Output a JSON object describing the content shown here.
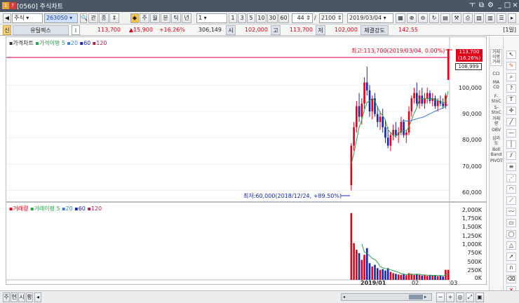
{
  "window": {
    "title": "[0560] 주식차트"
  },
  "toolbar1": {
    "market": "주식",
    "code": "263050",
    "buttons": [
      "관",
      "종"
    ],
    "periods": [
      "주",
      "월",
      "분",
      "틱",
      "년"
    ],
    "interval_value": "1",
    "interval_options": [
      "1",
      "3",
      "5",
      "10",
      "30",
      "60"
    ],
    "count_value": "44",
    "count_total": "2100",
    "date": "2019/03/04"
  },
  "toolbar2": {
    "stock_name": "유틸렉스",
    "info_icon": "i",
    "price": "113,700",
    "change": "▲15,900",
    "change_pct": "+16.26%",
    "volume": "306,149",
    "open_label": "시",
    "open": "102,000",
    "high_label": "고",
    "high": "113,700",
    "low_label": "저",
    "low": "102,000",
    "strength_label": "체결강도",
    "strength": "142.55",
    "period_badge": "[1일]"
  },
  "price_legend": {
    "title": "가격차트",
    "ma_label": "가격이평",
    "ma_periods": [
      "5",
      "20",
      "60",
      "120"
    ]
  },
  "volume_legend": {
    "title": "거래량",
    "ma_label": "거래이평",
    "ma_periods": [
      "5",
      "20",
      "60",
      "120"
    ]
  },
  "annotations": {
    "high": "최고:113,700(2019/03/04, 0.00%)",
    "low": "최저:60,000(2018/12/24, +89.50%)",
    "last_price": "113,700",
    "last_pct": "(16.26%)",
    "cursor_price": "108,999"
  },
  "price_axis": [
    "100,000",
    "90,000",
    "80,000",
    "70,000",
    "60,000"
  ],
  "volume_axis": [
    "2,000K",
    "1,750K",
    "1,500K",
    "1,250K",
    "1,000K",
    "750K",
    "500K",
    "250K",
    "0K"
  ],
  "date_axis": [
    "2019/01",
    "02",
    "03"
  ],
  "right_tools": [
    "거래\n이평\n거래",
    "CCI",
    "MA\nCD",
    "F-\nStoC",
    "S-\nStoC",
    "거래\n량",
    "OBV",
    "심리\n도",
    "Boll\nBand",
    "PIVOT"
  ],
  "bottom_tabs": [
    "주",
    "현",
    "시",
    "황"
  ],
  "colors": {
    "up": "#e2001a",
    "down": "#1526b8",
    "ma5": "#2aa14a",
    "ma20": "#3a7fd0",
    "hline": "#e0287a"
  },
  "chart_data": {
    "type": "candlestick",
    "candles": [
      {
        "o": 62000,
        "h": 78000,
        "l": 60000,
        "c": 77000
      },
      {
        "o": 77000,
        "h": 86000,
        "l": 75000,
        "c": 84000
      },
      {
        "o": 84000,
        "h": 94000,
        "l": 82000,
        "c": 92000
      },
      {
        "o": 92000,
        "h": 97000,
        "l": 86000,
        "c": 88000
      },
      {
        "o": 88000,
        "h": 95000,
        "l": 85000,
        "c": 93000
      },
      {
        "o": 93000,
        "h": 103000,
        "l": 91000,
        "c": 101000
      },
      {
        "o": 101000,
        "h": 107000,
        "l": 96000,
        "c": 98000
      },
      {
        "o": 98000,
        "h": 100000,
        "l": 88000,
        "c": 90000
      },
      {
        "o": 90000,
        "h": 96000,
        "l": 87000,
        "c": 95000
      },
      {
        "o": 95000,
        "h": 97000,
        "l": 88000,
        "c": 89000
      },
      {
        "o": 89000,
        "h": 92000,
        "l": 84000,
        "c": 86000
      },
      {
        "o": 86000,
        "h": 90000,
        "l": 83000,
        "c": 88000
      },
      {
        "o": 88000,
        "h": 91000,
        "l": 82000,
        "c": 84000
      },
      {
        "o": 84000,
        "h": 87000,
        "l": 78000,
        "c": 80000
      },
      {
        "o": 80000,
        "h": 84000,
        "l": 76000,
        "c": 77000
      },
      {
        "o": 77000,
        "h": 82000,
        "l": 75000,
        "c": 81000
      },
      {
        "o": 81000,
        "h": 85000,
        "l": 79000,
        "c": 83000
      },
      {
        "o": 83000,
        "h": 86000,
        "l": 80000,
        "c": 81000
      },
      {
        "o": 81000,
        "h": 84000,
        "l": 78000,
        "c": 82000
      },
      {
        "o": 82000,
        "h": 88000,
        "l": 81000,
        "c": 86000
      },
      {
        "o": 86000,
        "h": 87000,
        "l": 80000,
        "c": 81000
      },
      {
        "o": 81000,
        "h": 83000,
        "l": 78000,
        "c": 82000
      },
      {
        "o": 82000,
        "h": 92000,
        "l": 81000,
        "c": 90000
      },
      {
        "o": 90000,
        "h": 96000,
        "l": 88000,
        "c": 95000
      },
      {
        "o": 95000,
        "h": 99000,
        "l": 93000,
        "c": 97000
      },
      {
        "o": 97000,
        "h": 101000,
        "l": 92000,
        "c": 93000
      },
      {
        "o": 93000,
        "h": 98000,
        "l": 91000,
        "c": 96000
      },
      {
        "o": 96000,
        "h": 99000,
        "l": 92000,
        "c": 93000
      },
      {
        "o": 93000,
        "h": 97000,
        "l": 91000,
        "c": 95000
      },
      {
        "o": 95000,
        "h": 99000,
        "l": 93000,
        "c": 97000
      },
      {
        "o": 97000,
        "h": 98000,
        "l": 93000,
        "c": 94000
      },
      {
        "o": 94000,
        "h": 97000,
        "l": 92000,
        "c": 95000
      },
      {
        "o": 95000,
        "h": 96000,
        "l": 91000,
        "c": 92000
      },
      {
        "o": 92000,
        "h": 95000,
        "l": 90000,
        "c": 94000
      },
      {
        "o": 94000,
        "h": 96000,
        "l": 92000,
        "c": 93000
      },
      {
        "o": 93000,
        "h": 95000,
        "l": 91000,
        "c": 92000
      },
      {
        "o": 92000,
        "h": 97000,
        "l": 91000,
        "c": 96000
      },
      {
        "o": 102000,
        "h": 113700,
        "l": 102000,
        "c": 113700
      }
    ],
    "ma5": [
      70000,
      74000,
      79000,
      84000,
      86800,
      90600,
      93400,
      94000,
      95000,
      94000,
      91600,
      89600,
      88400,
      86800,
      83000,
      82000,
      80800,
      80600,
      81600,
      82600,
      82600,
      82600,
      84200,
      86800,
      89400,
      91400,
      94800,
      94800,
      94800,
      95000,
      94600,
      95000,
      94400,
      94200,
      93600,
      93200,
      93600,
      97600
    ],
    "ma20": [
      null,
      null,
      null,
      null,
      null,
      null,
      null,
      null,
      null,
      null,
      null,
      null,
      null,
      null,
      null,
      null,
      null,
      null,
      null,
      86200,
      86500,
      86300,
      86400,
      86600,
      86900,
      87200,
      87500,
      87700,
      88100,
      88600,
      89100,
      89600,
      90100,
      90500,
      90900,
      91400,
      91900,
      92600
    ],
    "volume": [
      2000000,
      1100000,
      900000,
      800000,
      600000,
      750000,
      950000,
      500000,
      400000,
      450000,
      350000,
      300000,
      320000,
      280000,
      350000,
      240000,
      200000,
      180000,
      160000,
      150000,
      170000,
      140000,
      200000,
      180000,
      150000,
      160000,
      150000,
      130000,
      140000,
      120000,
      150000,
      130000,
      140000,
      110000,
      120000,
      100000,
      300000,
      300000
    ],
    "vol_ma5": [
      null,
      null,
      null,
      null,
      1080000,
      830000,
      800000,
      720000,
      640000,
      610000,
      530000,
      400000,
      360000,
      340000,
      320000,
      300000,
      278000,
      254000,
      226000,
      186000,
      172000,
      160000,
      164000,
      168000,
      168000,
      170000,
      168000,
      154000,
      146000,
      140000,
      138000,
      134000,
      138000,
      130000,
      130000,
      122000,
      154000,
      194000
    ],
    "y_range": [
      58000,
      115000
    ],
    "vol_range": [
      0,
      2100000
    ],
    "x_labels": [
      "2019/01",
      "02",
      "03"
    ]
  }
}
